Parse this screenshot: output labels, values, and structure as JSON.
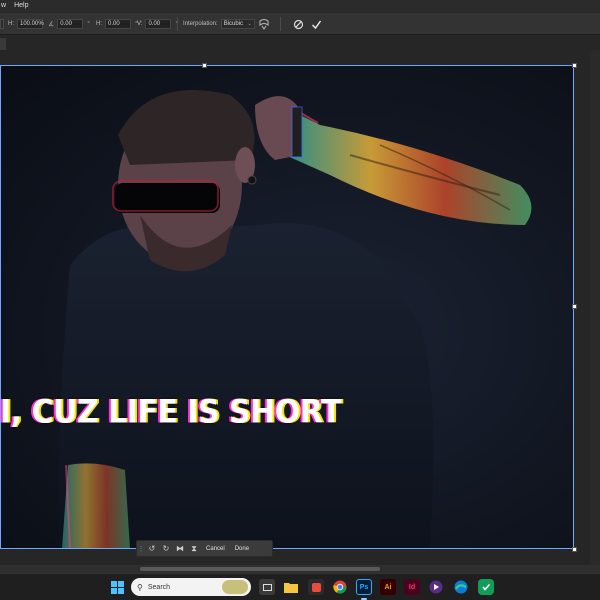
{
  "menubar": {
    "items": [
      "w",
      "Help"
    ]
  },
  "options": {
    "h_label": "H:",
    "scale_value": "100.00%",
    "angle_value": "0.00",
    "hskew_label": "H:",
    "hskew_value": "0.00",
    "vskew_label": "V:",
    "vskew_value": "0.00",
    "interpolation_label": "Interpolation:",
    "interpolation_value": "Bicubic"
  },
  "canvas": {
    "headline": "I, CUZ LIFE IS SHORT"
  },
  "context_taskbar": {
    "cancel_label": "Cancel",
    "done_label": "Done"
  },
  "windows_taskbar": {
    "search_placeholder": "Search",
    "apps": [
      "Start",
      "Task View",
      "File Explorer",
      "Store",
      "Chrome",
      "Photoshop",
      "Illustrator",
      "InDesign",
      "Media Player",
      "Edge",
      "Security"
    ],
    "ps_label": "Ps",
    "ai_label": "Ai",
    "id_label": "Id"
  },
  "colors": {
    "accent": "#6fa8ff",
    "headline_fill": "#ffffff",
    "headline_magenta": "#ff2bd6",
    "headline_yellow": "#f2e400"
  }
}
